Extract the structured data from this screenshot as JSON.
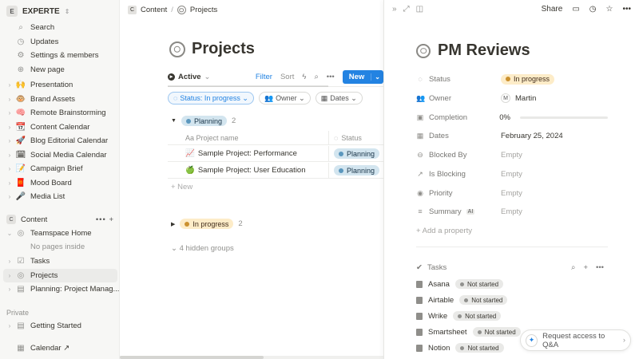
{
  "sidebar": {
    "workspace": {
      "badge": "E",
      "name": "EXPERTE"
    },
    "top_items": [
      {
        "icon": "🔍",
        "label": "Search"
      },
      {
        "icon": "⊙",
        "label": "Updates"
      },
      {
        "icon": "⚙",
        "label": "Settings & members"
      },
      {
        "icon": "⊕",
        "label": "New page"
      }
    ],
    "pages": [
      {
        "icon": "🙌",
        "label": "Presentation"
      },
      {
        "icon": "🐵",
        "label": "Brand Assets"
      },
      {
        "icon": "🧠",
        "label": "Remote Brainstorming"
      },
      {
        "icon": "📆",
        "label": "Content Calendar"
      },
      {
        "icon": "🚀",
        "label": "Blog Editorial Calendar"
      },
      {
        "icon": "🗓",
        "label": "Social Media Calendar"
      },
      {
        "icon": "📝",
        "label": "Campaign Brief"
      },
      {
        "icon": "🧧",
        "label": "Mood Board"
      },
      {
        "icon": "🎤",
        "label": "Media List"
      }
    ],
    "teamspace": {
      "badge": "C",
      "name": "Content",
      "actions": "•••  +"
    },
    "team_items": [
      {
        "icon": "◎",
        "label": "Teamspace Home"
      },
      {
        "icon": "",
        "label": "No pages inside"
      },
      {
        "icon": "☑",
        "label": "Tasks"
      },
      {
        "icon": "◎",
        "label": "Projects"
      },
      {
        "icon": "▤",
        "label": "Planning: Project Manag..."
      }
    ],
    "private_label": "Private",
    "private_items": [
      {
        "icon": "▤",
        "label": "Getting Started"
      }
    ],
    "calendar": {
      "label": "Calendar ↗"
    }
  },
  "breadcrumb": {
    "badge": "C",
    "items": [
      "Content",
      "/",
      "Projects"
    ]
  },
  "page": {
    "title": "Projects"
  },
  "view": {
    "active_label": "Active",
    "filter_label": "Filter",
    "sort_label": "Sort",
    "new_label": "New",
    "chips": [
      {
        "label": "Status: In progress ⌄"
      },
      {
        "label": "Owner ⌄"
      },
      {
        "label": "Dates ⌄"
      }
    ]
  },
  "groups": {
    "planning": {
      "label": "Planning",
      "count": "2"
    },
    "in_progress": {
      "label": "In progress",
      "count": "2"
    },
    "hidden": "4 hidden groups"
  },
  "table": {
    "col_name": "Aa  Project name",
    "col_status": "Status",
    "rows": [
      {
        "icon": "📈",
        "name": "Sample Project: Performance",
        "status": "Planning"
      },
      {
        "icon": "🍏",
        "name": "Sample Project: User Education",
        "status": "Planning"
      }
    ],
    "add_new": "+  New"
  },
  "peek": {
    "share_label": "Share",
    "title": "PM Reviews",
    "props": [
      {
        "icon": "◌",
        "key": "Status",
        "value": "In progress"
      },
      {
        "icon": "👥",
        "key": "Owner",
        "value": "Martin",
        "avatar": "M"
      },
      {
        "icon": "▣",
        "key": "Completion",
        "value": "0%"
      },
      {
        "icon": "▦",
        "key": "Dates",
        "value": "February 25, 2024"
      },
      {
        "icon": "⊖",
        "key": "Blocked By",
        "value": "Empty"
      },
      {
        "icon": "↗",
        "key": "Is Blocking",
        "value": "Empty"
      },
      {
        "icon": "◉",
        "key": "Priority",
        "value": "Empty"
      },
      {
        "icon": "≡",
        "key": "Summary",
        "value": "Empty",
        "badge": "AI"
      }
    ],
    "add_property": "+   Add a property",
    "tasks_label": "Tasks",
    "tasks": [
      {
        "name": "Asana",
        "status": "Not started"
      },
      {
        "name": "Airtable",
        "status": "Not started"
      },
      {
        "name": "Wrike",
        "status": "Not started"
      },
      {
        "name": "Smartsheet",
        "status": "Not started"
      },
      {
        "name": "Notion",
        "status": "Not started"
      }
    ],
    "completion": 0
  },
  "qa": {
    "label": "Request access to Q&A"
  }
}
